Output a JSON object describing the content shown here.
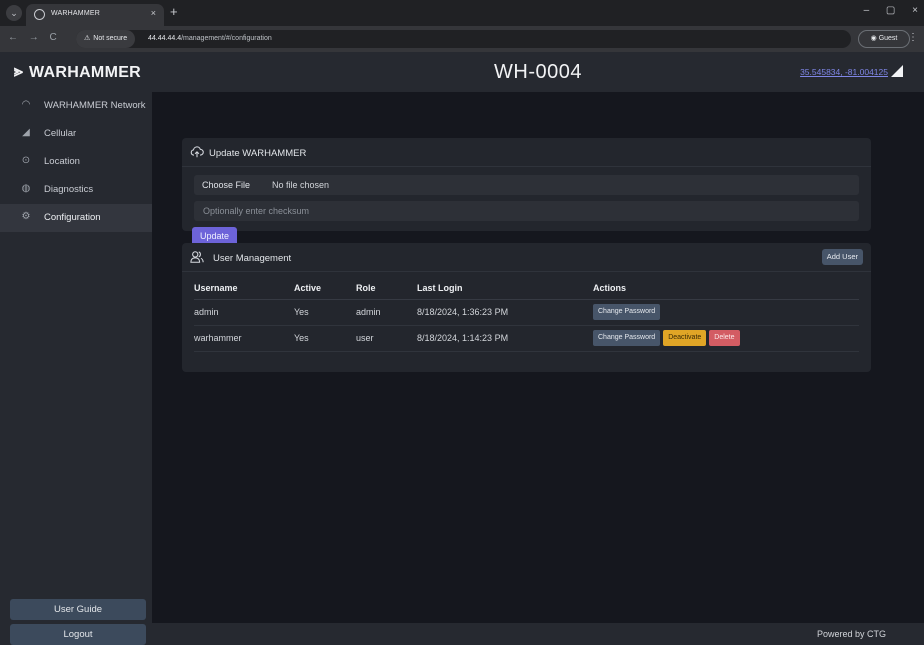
{
  "browser": {
    "tab_title": "WARHAMMER",
    "tab_close": "×",
    "new_tab": "+",
    "window_controls": "– ▢ ×",
    "nav_icons": "← → C",
    "security_label": "Not secure",
    "url_host": "44.44.44.4",
    "url_path": "/management/#/configuration",
    "profile": "Guest",
    "menu": "⋮"
  },
  "brand": {
    "mark": "⪢",
    "name": "WARHAMMER"
  },
  "sidebar": {
    "items": [
      {
        "label": "WARHAMMER Network",
        "icon": "gauge-icon"
      },
      {
        "label": "Cellular",
        "icon": "signal-icon"
      },
      {
        "label": "Location",
        "icon": "location-pin-icon"
      },
      {
        "label": "Diagnostics",
        "icon": "diagnostics-icon"
      },
      {
        "label": "Configuration",
        "icon": "gear-icon",
        "active": true
      }
    ],
    "user_guide": "User Guide",
    "logout": "Logout"
  },
  "header": {
    "device": "WH-0004",
    "coords": "35.545834, -81.004125"
  },
  "update_card": {
    "title": "Update WARHAMMER",
    "choose_file": "Choose File",
    "file_status": "No file chosen",
    "checksum_placeholder": "Optionally enter checksum",
    "update_button": "Update"
  },
  "users_card": {
    "title": "User Management",
    "add_user": "Add User",
    "columns": [
      "Username",
      "Active",
      "Role",
      "Last Login",
      "Actions"
    ],
    "rows": [
      {
        "username": "admin",
        "active": "Yes",
        "role": "admin",
        "last_login": "8/18/2024, 1:36:23 PM",
        "change": "Change Password"
      },
      {
        "username": "warhammer",
        "active": "Yes",
        "role": "user",
        "last_login": "8/18/2024, 1:14:23 PM",
        "change": "Change Password",
        "deactivate": "Deactivate",
        "delete": "Delete"
      }
    ]
  },
  "footer": {
    "text": "Powered by CTG"
  },
  "colors": {
    "accent": "#6d63d9",
    "link": "#7f86e6",
    "warning": "#e0a526",
    "danger": "#d35c63",
    "secondary": "#475569"
  }
}
